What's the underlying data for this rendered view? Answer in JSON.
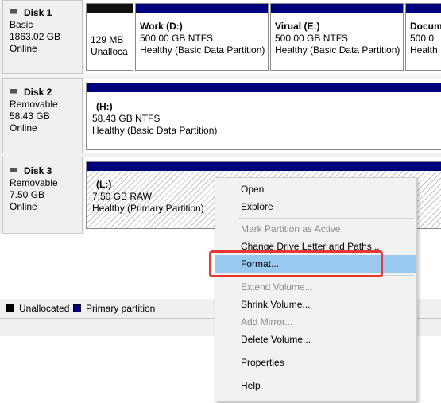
{
  "disks": [
    {
      "name": "Disk 1",
      "type": "Basic",
      "size": "1863.02 GB",
      "status": "Online",
      "partitions": [
        {
          "kind": "unallocated",
          "size": "129 MB",
          "status": "Unalloca"
        },
        {
          "kind": "primary",
          "title": "Work  (D:)",
          "size": "500.00 GB NTFS",
          "status": "Healthy (Basic Data Partition)"
        },
        {
          "kind": "primary",
          "title": "Virual  (E:)",
          "size": "500.00 GB NTFS",
          "status": "Healthy (Basic Data Partition)"
        },
        {
          "kind": "primary",
          "title": "Docum",
          "size": "500.0",
          "status": "Health"
        }
      ]
    },
    {
      "name": "Disk 2",
      "type": "Removable",
      "size": "58.43 GB",
      "status": "Online",
      "partitions": [
        {
          "kind": "primary",
          "title": "(H:)",
          "size": "58.43 GB NTFS",
          "status": "Healthy (Basic Data Partition)"
        }
      ]
    },
    {
      "name": "Disk 3",
      "type": "Removable",
      "size": "7.50 GB",
      "status": "Online",
      "partitions": [
        {
          "kind": "primary",
          "title": "(L:)",
          "size": "7.50 GB RAW",
          "status": "Healthy (Primary Partition)"
        }
      ]
    }
  ],
  "legend": {
    "unallocated": "Unallocated",
    "primary": "Primary partition"
  },
  "context_menu": {
    "items": [
      {
        "label": "Open",
        "disabled": false
      },
      {
        "label": "Explore",
        "disabled": false
      },
      {
        "label": "Mark Partition as Active",
        "disabled": true
      },
      {
        "label": "Change Drive Letter and Paths...",
        "disabled": false
      },
      {
        "label": "Format...",
        "disabled": false,
        "selected": true
      },
      {
        "label": "Extend Volume...",
        "disabled": true
      },
      {
        "label": "Shrink Volume...",
        "disabled": false
      },
      {
        "label": "Add Mirror...",
        "disabled": true
      },
      {
        "label": "Delete Volume...",
        "disabled": false
      },
      {
        "label": "Properties",
        "disabled": false
      },
      {
        "label": "Help",
        "disabled": false
      }
    ]
  },
  "colors": {
    "primary_bar": "#00007f",
    "unallocated_bar": "#111111",
    "menu_selected": "#99c9f0",
    "highlight_border": "#e53935"
  }
}
